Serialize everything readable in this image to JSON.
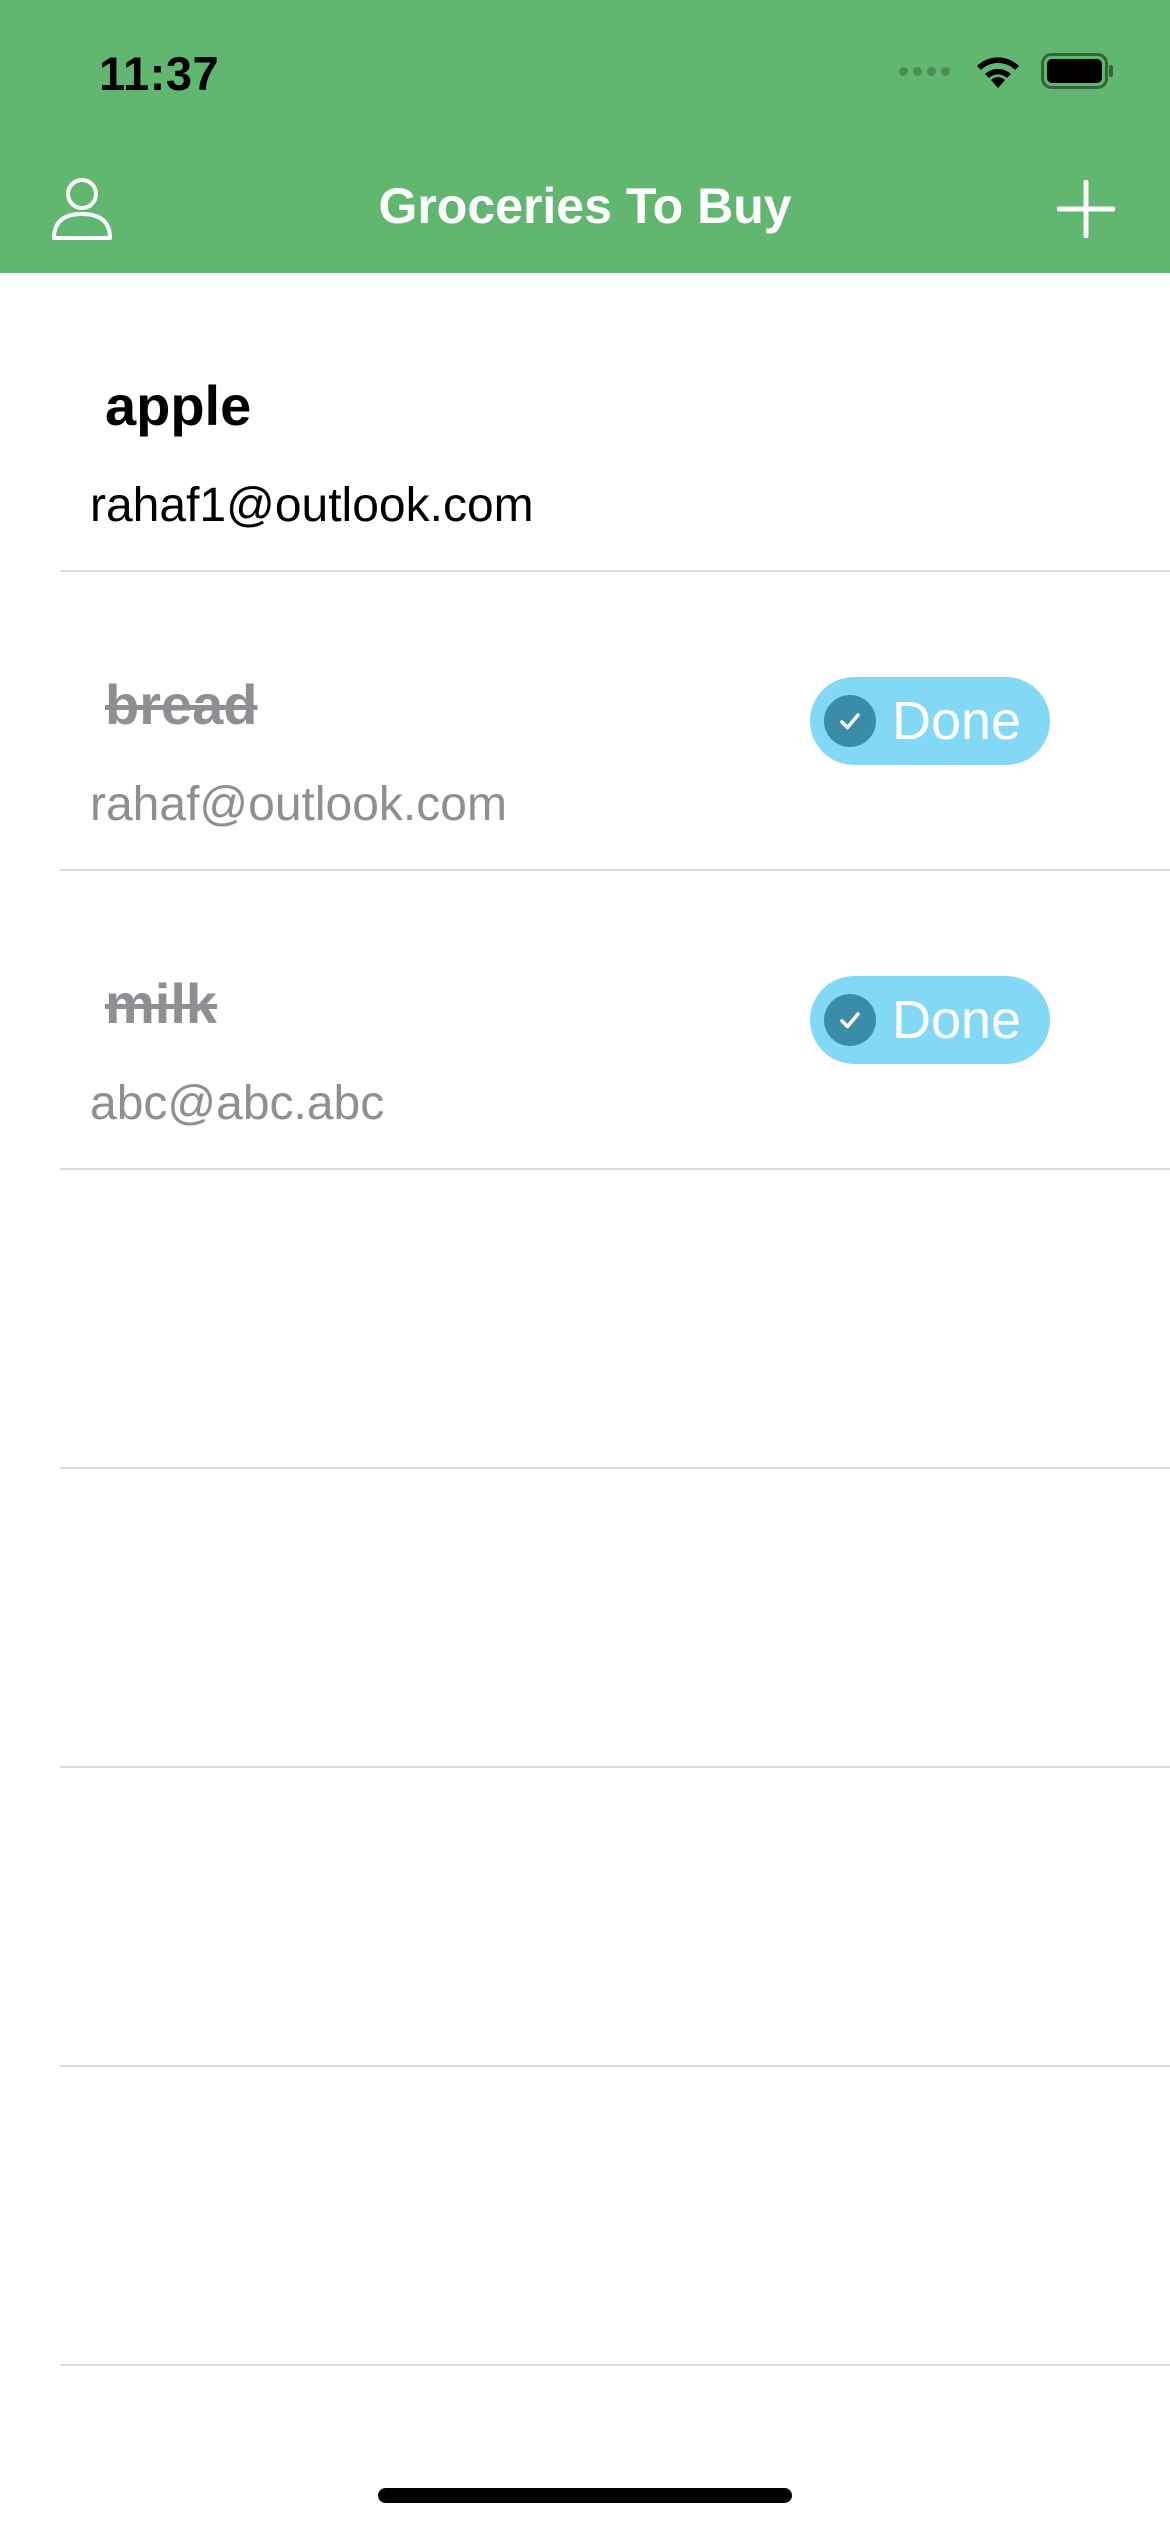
{
  "status_bar": {
    "time": "11:37",
    "wifi_icon": "wifi-icon",
    "battery_icon": "battery-icon"
  },
  "nav": {
    "title": "Groceries To Buy",
    "left_icon": "person-icon",
    "right_icon": "plus-icon"
  },
  "items": [
    {
      "name": "apple",
      "email": "rahaf1@outlook.com",
      "done": false
    },
    {
      "name": "bread",
      "email": "rahaf@outlook.com",
      "done": true,
      "badge": "Done"
    },
    {
      "name": "milk",
      "email": "abc@abc.abc",
      "done": true,
      "badge": "Done"
    }
  ],
  "colors": {
    "header": "#61b770",
    "badge": "#82d8f5",
    "badge_check": "#3b8ca8",
    "done_text": "#8e8e93"
  }
}
